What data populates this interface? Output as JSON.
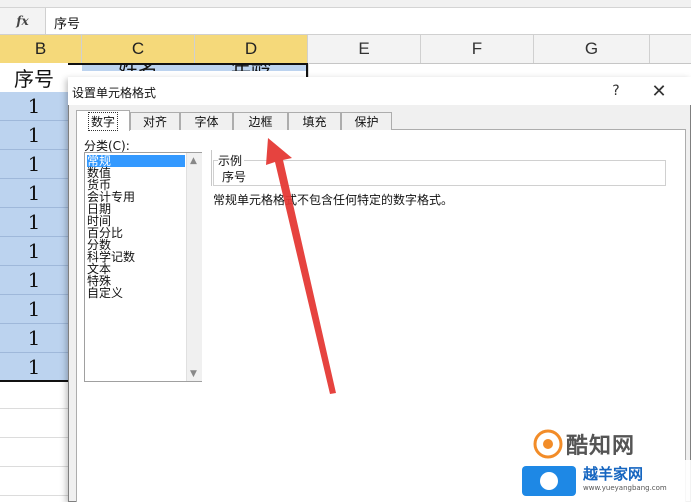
{
  "formula_bar": {
    "fx_label": "fx",
    "value": "序号"
  },
  "columns": [
    {
      "label": "B",
      "selected": true
    },
    {
      "label": "C",
      "selected": true
    },
    {
      "label": "D",
      "selected": true
    },
    {
      "label": "E",
      "selected": false
    },
    {
      "label": "F",
      "selected": false
    },
    {
      "label": "G",
      "selected": false
    }
  ],
  "sheet": {
    "header_row": [
      "序号",
      "姓名",
      "年龄"
    ],
    "column_b_values": [
      "1",
      "1",
      "1",
      "1",
      "1",
      "1",
      "1",
      "1",
      "1",
      "1"
    ]
  },
  "dialog": {
    "title": "设置单元格格式",
    "help": "?",
    "close": "✕",
    "tabs": [
      {
        "label": "数字",
        "active": true
      },
      {
        "label": "对齐",
        "active": false
      },
      {
        "label": "字体",
        "active": false
      },
      {
        "label": "边框",
        "active": false
      },
      {
        "label": "填充",
        "active": false
      },
      {
        "label": "保护",
        "active": false
      }
    ],
    "category_label": "分类(C):",
    "categories": [
      "常规",
      "数值",
      "货币",
      "会计专用",
      "日期",
      "时间",
      "百分比",
      "分数",
      "科学记数",
      "文本",
      "特殊",
      "自定义"
    ],
    "selected_category": "常规",
    "sample_label": "示例",
    "sample_value": "序号",
    "description": "常规单元格格式不包含任何特定的数字格式。"
  },
  "watermarks": {
    "primary": "酷知网",
    "secondary": "越羊家网",
    "secondary_url": "www.yueyangbang.com"
  },
  "colors": {
    "selection": "#bcd3ef",
    "header_selected": "#f5d97a",
    "arrow": "#e53935",
    "list_selected": "#3399ff"
  }
}
